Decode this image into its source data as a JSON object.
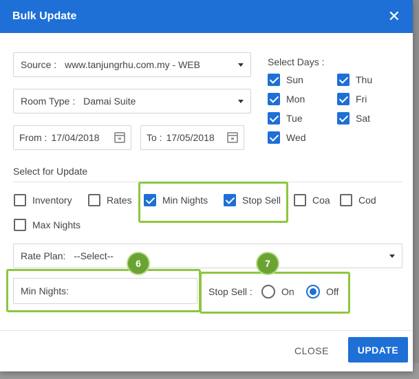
{
  "dialog": {
    "title": "Bulk Update"
  },
  "source": {
    "label": "Source :",
    "value": "www.tanjungrhu.com.my - WEB"
  },
  "room_type": {
    "label": "Room Type :",
    "value": "Damai Suite"
  },
  "from": {
    "label": "From :",
    "value": "17/04/2018"
  },
  "to": {
    "label": "To :",
    "value": "17/05/2018"
  },
  "select_days": {
    "label": "Select Days :",
    "days": [
      {
        "label": "Sun",
        "checked": true
      },
      {
        "label": "Thu",
        "checked": true
      },
      {
        "label": "Mon",
        "checked": true
      },
      {
        "label": "Fri",
        "checked": true
      },
      {
        "label": "Tue",
        "checked": true
      },
      {
        "label": "Sat",
        "checked": true
      },
      {
        "label": "Wed",
        "checked": true
      }
    ]
  },
  "select_for_update": {
    "label": "Select for Update",
    "options": [
      {
        "label": "Inventory",
        "checked": false
      },
      {
        "label": "Rates",
        "checked": false
      },
      {
        "label": "Min Nights",
        "checked": true
      },
      {
        "label": "Stop Sell",
        "checked": true
      },
      {
        "label": "Coa",
        "checked": false
      },
      {
        "label": "Cod",
        "checked": false
      },
      {
        "label": "Max Nights",
        "checked": false
      }
    ]
  },
  "rate_plan": {
    "label": "Rate Plan:",
    "value": "--Select--"
  },
  "min_nights": {
    "label": "Min Nights:",
    "badge": "6"
  },
  "stop_sell": {
    "label": "Stop Sell :",
    "badge": "7",
    "on_label": "On",
    "off_label": "Off",
    "selected": "Off"
  },
  "footer": {
    "close_label": "CLOSE",
    "update_label": "UPDATE"
  },
  "colors": {
    "primary": "#1e6fd6",
    "highlight": "#8dc63f",
    "badge": "#6aa332"
  }
}
